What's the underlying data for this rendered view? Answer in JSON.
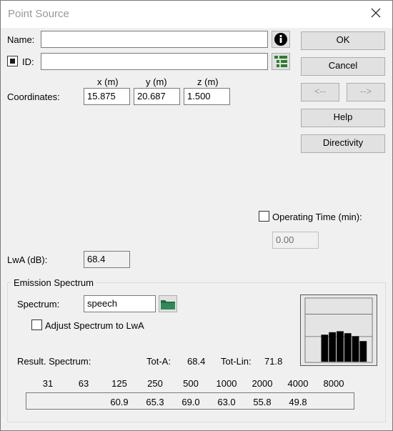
{
  "window": {
    "title": "Point Source"
  },
  "name": {
    "label": "Name:",
    "value": ""
  },
  "id": {
    "label": "ID:",
    "checked": true,
    "value": ""
  },
  "coords": {
    "label": "Coordinates:",
    "x_label": "x (m)",
    "y_label": "y (m)",
    "z_label": "z (m)",
    "x": "15.875",
    "y": "20.687",
    "z": "1.500"
  },
  "buttons": {
    "ok": "OK",
    "cancel": "Cancel",
    "prev": "<--",
    "next": "-->",
    "help": "Help",
    "directivity": "Directivity"
  },
  "operating_time": {
    "label": "Operating Time (min):",
    "checked": false,
    "value": "0.00"
  },
  "lwa": {
    "label": "LwA (dB):",
    "value": "68.4"
  },
  "emission": {
    "title": "Emission Spectrum",
    "spectrum_label": "Spectrum:",
    "spectrum_value": "speech",
    "adjust_label": "Adjust Spectrum to LwA",
    "adjust_checked": false,
    "result_label": "Result. Spectrum:",
    "tota_label": "Tot-A:",
    "tota_value": "68.4",
    "totlin_label": "Tot-Lin:",
    "totlin_value": "71.8",
    "bands": [
      "31",
      "63",
      "125",
      "250",
      "500",
      "1000",
      "2000",
      "4000",
      "8000"
    ],
    "values": [
      "",
      "",
      "60.9",
      "65.3",
      "69.0",
      "63.0",
      "55.8",
      "49.8",
      ""
    ],
    "preview_levels": [
      0.55,
      0.6,
      0.62,
      0.58,
      0.52,
      0.42
    ]
  },
  "icons": {
    "info": "info-circle-icon",
    "id_list": "list-tree-icon",
    "folder": "folder-icon",
    "close": "close-x-icon"
  },
  "colors": {
    "folder_fill": "#2e8b57",
    "id_icon_green": "#2d7d2d"
  }
}
